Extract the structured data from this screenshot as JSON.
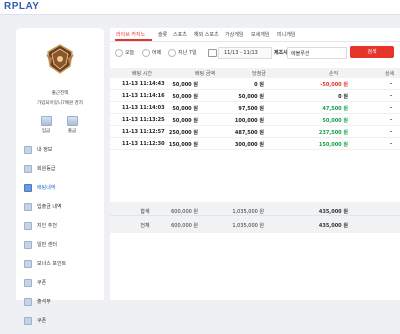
{
  "header": {
    "logo": "RPLAY",
    "menu": [
      "",
      "",
      "",
      ""
    ]
  },
  "sidebar": {
    "user_name": "출근전액",
    "balance_text": "가입되어있니7예원 경지",
    "mini_buttons": [
      {
        "label": "입금",
        "icon": "deposit-icon"
      },
      {
        "label": "출금",
        "icon": "withdraw-icon"
      }
    ],
    "items": [
      {
        "label": "내 정보",
        "icon": "profile-icon",
        "active": false
      },
      {
        "label": "회원등급",
        "icon": "grade-icon",
        "active": false
      },
      {
        "label": "배팅내역",
        "icon": "betting-history-icon",
        "active": true
      },
      {
        "label": "입출금 내역",
        "icon": "transaction-icon",
        "active": false
      },
      {
        "label": "지인 추천",
        "icon": "referral-icon",
        "active": false
      },
      {
        "label": "일반 센터",
        "icon": "center-icon",
        "active": false
      },
      {
        "label": "보너스 포인트",
        "icon": "bonus-point-icon",
        "active": false
      },
      {
        "label": "쿠폰",
        "icon": "coupon-icon",
        "active": false
      },
      {
        "label": "출석부",
        "icon": "attendance-icon",
        "active": false
      },
      {
        "label": "쿠폰",
        "icon": "coupon-icon",
        "active": false
      }
    ]
  },
  "tabs": [
    "라이브 카지노",
    "슬롯",
    "스포츠",
    "해외 스포츠",
    "가상게임",
    "보세게임",
    "미니게임"
  ],
  "filters": {
    "options": [
      "오늘",
      "어제",
      "지난 7일"
    ],
    "date_range": "11/13 - 11/13",
    "provider_label": "제조사:",
    "provider_value": "에볼루션",
    "search_button": "검색"
  },
  "table": {
    "headers": [
      "배팅 시간",
      "배팅 금액",
      "당첨금",
      "손익",
      "상세"
    ],
    "rows": [
      [
        "11-13 11:14:43",
        "50,000 원",
        "0 원",
        "-50,000 원",
        "-"
      ],
      [
        "11-13 11:14:16",
        "50,000 원",
        "50,000 원",
        "0 원",
        "-"
      ],
      [
        "11-13 11:14:03",
        "50,000 원",
        "97,500 원",
        "47,500 원",
        "-"
      ],
      [
        "11-13 11:13:25",
        "50,000 원",
        "100,000 원",
        "50,000 원",
        "-"
      ],
      [
        "11-13 11:12:57",
        "250,000 원",
        "487,500 원",
        "237,500 원",
        "-"
      ],
      [
        "11-13 11:12:30",
        "150,000 원",
        "300,000 원",
        "150,000 원",
        "-"
      ]
    ],
    "row_signs": [
      "neg",
      "zero",
      "pos",
      "pos",
      "pos",
      "pos"
    ],
    "subtotal": {
      "label": "합계",
      "bet": "600,000 원",
      "win": "1,035,000 원",
      "profit": "435,000 원"
    },
    "total": {
      "label": "전체",
      "bet": "600,000 원",
      "win": "1,035,000 원",
      "profit": "435,000 원"
    }
  },
  "colors": {
    "accent": "#e6342b",
    "positive": "#12a14a",
    "active_menu": "#2f72c9"
  }
}
